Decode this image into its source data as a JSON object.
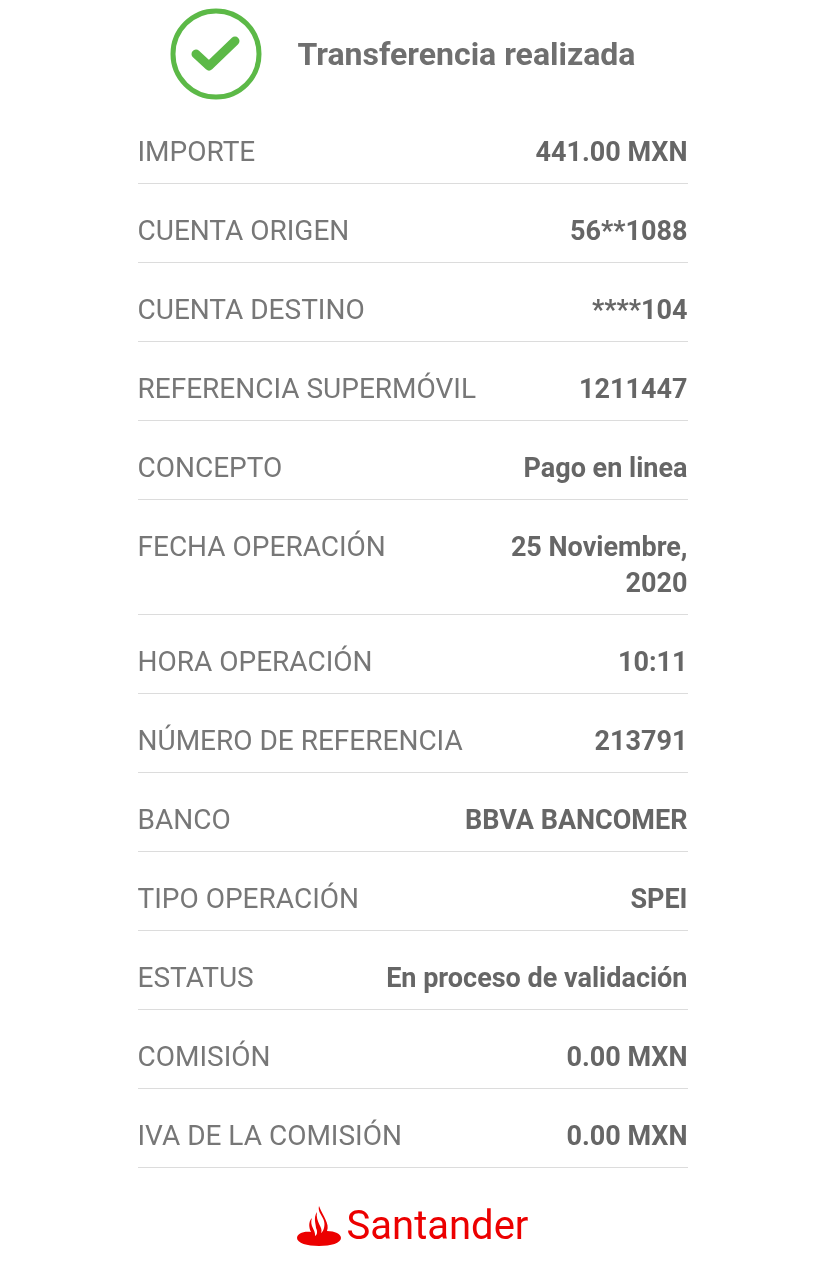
{
  "header": {
    "title": "Transferencia realizada"
  },
  "details": [
    {
      "label": "IMPORTE",
      "value": "441.00 MXN"
    },
    {
      "label": "CUENTA ORIGEN",
      "value": "56**1088"
    },
    {
      "label": "CUENTA DESTINO",
      "value": "****104"
    },
    {
      "label": "REFERENCIA SUPERMÓVIL",
      "value": "1211447"
    },
    {
      "label": "CONCEPTO",
      "value": "Pago en linea"
    },
    {
      "label": "FECHA OPERACIÓN",
      "value": "25 Noviembre, 2020"
    },
    {
      "label": "HORA OPERACIÓN",
      "value": "10:11"
    },
    {
      "label": "NÚMERO DE REFERENCIA",
      "value": "213791"
    },
    {
      "label": "BANCO",
      "value": "BBVA BANCOMER"
    },
    {
      "label": "TIPO OPERACIÓN",
      "value": "SPEI"
    },
    {
      "label": "ESTATUS",
      "value": "En proceso de validación"
    },
    {
      "label": "COMISIÓN",
      "value": "0.00 MXN"
    },
    {
      "label": "IVA DE LA COMISIÓN",
      "value": "0.00 MXN"
    }
  ],
  "footer": {
    "brand": "Santander"
  }
}
